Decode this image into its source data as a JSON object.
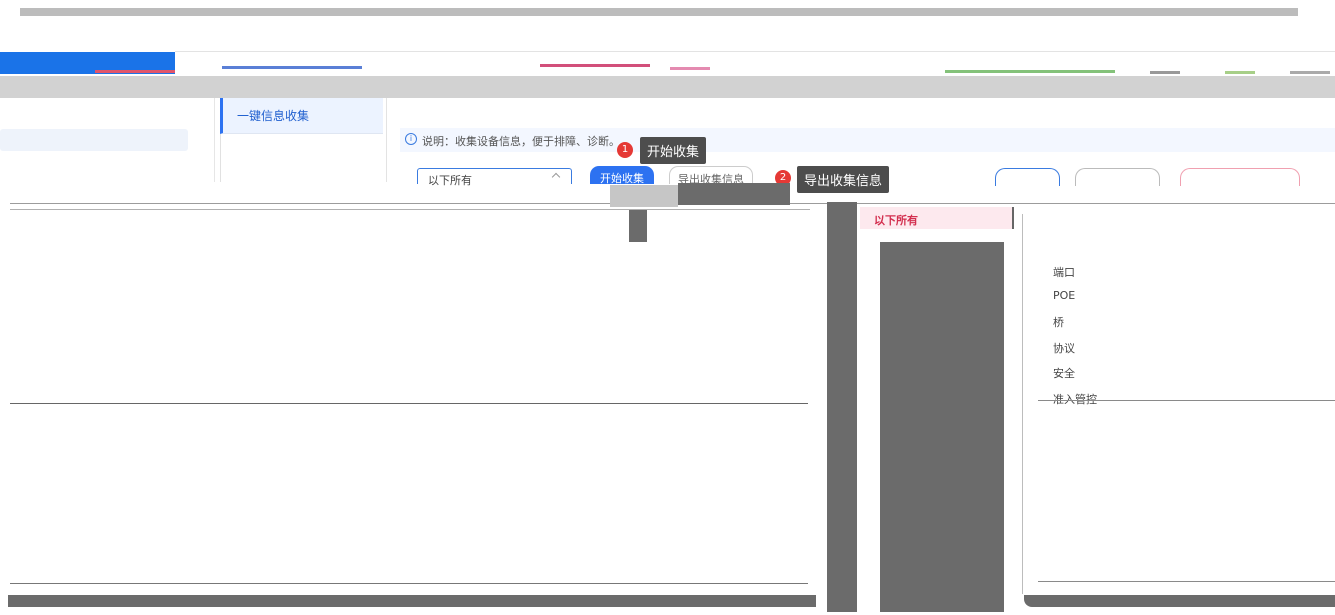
{
  "menu": {
    "item_label": "一键信息收集"
  },
  "info": {
    "icon": "info-circle-icon",
    "text": "说明：收集设备信息，便于排障、诊断。"
  },
  "toolbar": {
    "select_value": "以下所有",
    "start_label": "开始收集",
    "export_label": "导出收集信息"
  },
  "annotations": {
    "step1_number": "1",
    "step1_tip": "开始收集",
    "step2_number": "2",
    "step2_tip": "导出收集信息"
  },
  "dropdown": {
    "selected_option": "以下所有"
  },
  "right_list": {
    "items": [
      "端口",
      "POE",
      "桥",
      "协议",
      "安全",
      "准入管控"
    ]
  },
  "colors": {
    "accent": "#2d72f1",
    "badge": "#e53935",
    "selected_option": "#d32f4f"
  }
}
